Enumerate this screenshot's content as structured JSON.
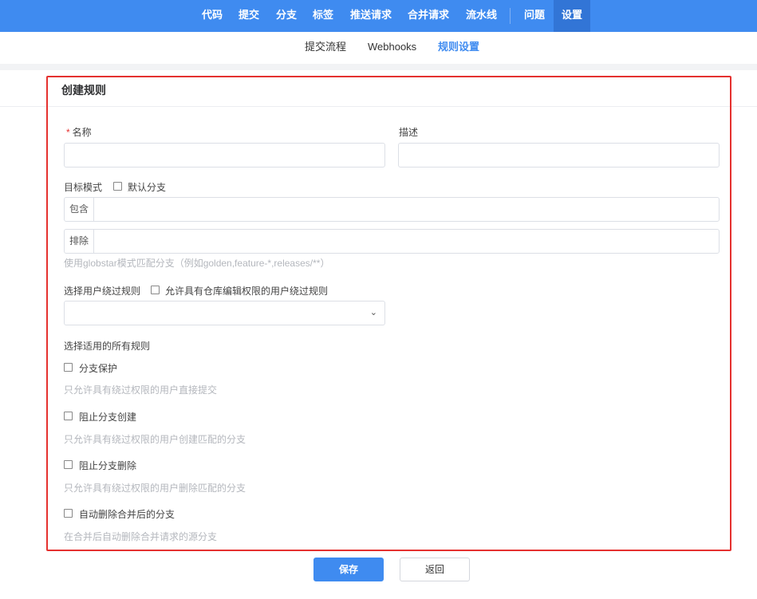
{
  "topnav": {
    "items": [
      "代码",
      "提交",
      "分支",
      "标签",
      "推送请求",
      "合并请求",
      "流水线",
      "问题",
      "设置"
    ],
    "active": "设置"
  },
  "subnav": {
    "items": [
      "提交流程",
      "Webhooks",
      "规则设置"
    ],
    "active": "规则设置"
  },
  "form": {
    "title": "创建规则",
    "name_required_mark": "*",
    "name_label": "名称",
    "name_value": "",
    "desc_label": "描述",
    "desc_value": "",
    "target_label": "目标模式",
    "default_branch_label": "默认分支",
    "default_branch_checked": false,
    "include_prefix": "包含",
    "include_value": "",
    "exclude_prefix": "排除",
    "exclude_value": "",
    "pattern_hint": "使用globstar模式匹配分支（例如golden,feature-*,releases/**）",
    "bypass_label": "选择用户绕过规则",
    "allow_repo_edit_label": "允许具有仓库编辑权限的用户绕过规则",
    "allow_repo_edit_checked": false,
    "bypass_select_value": "",
    "rules_label": "选择适用的所有规则",
    "rules": [
      {
        "label": "分支保护",
        "hint": "只允许具有绕过权限的用户直接提交",
        "checked": false
      },
      {
        "label": "阻止分支创建",
        "hint": "只允许具有绕过权限的用户创建匹配的分支",
        "checked": false
      },
      {
        "label": "阻止分支删除",
        "hint": "只允许具有绕过权限的用户删除匹配的分支",
        "checked": false
      },
      {
        "label": "自动删除合并后的分支",
        "hint": "在合并后自动删除合并请求的源分支",
        "checked": false
      }
    ],
    "save_label": "保存",
    "back_label": "返回"
  }
}
